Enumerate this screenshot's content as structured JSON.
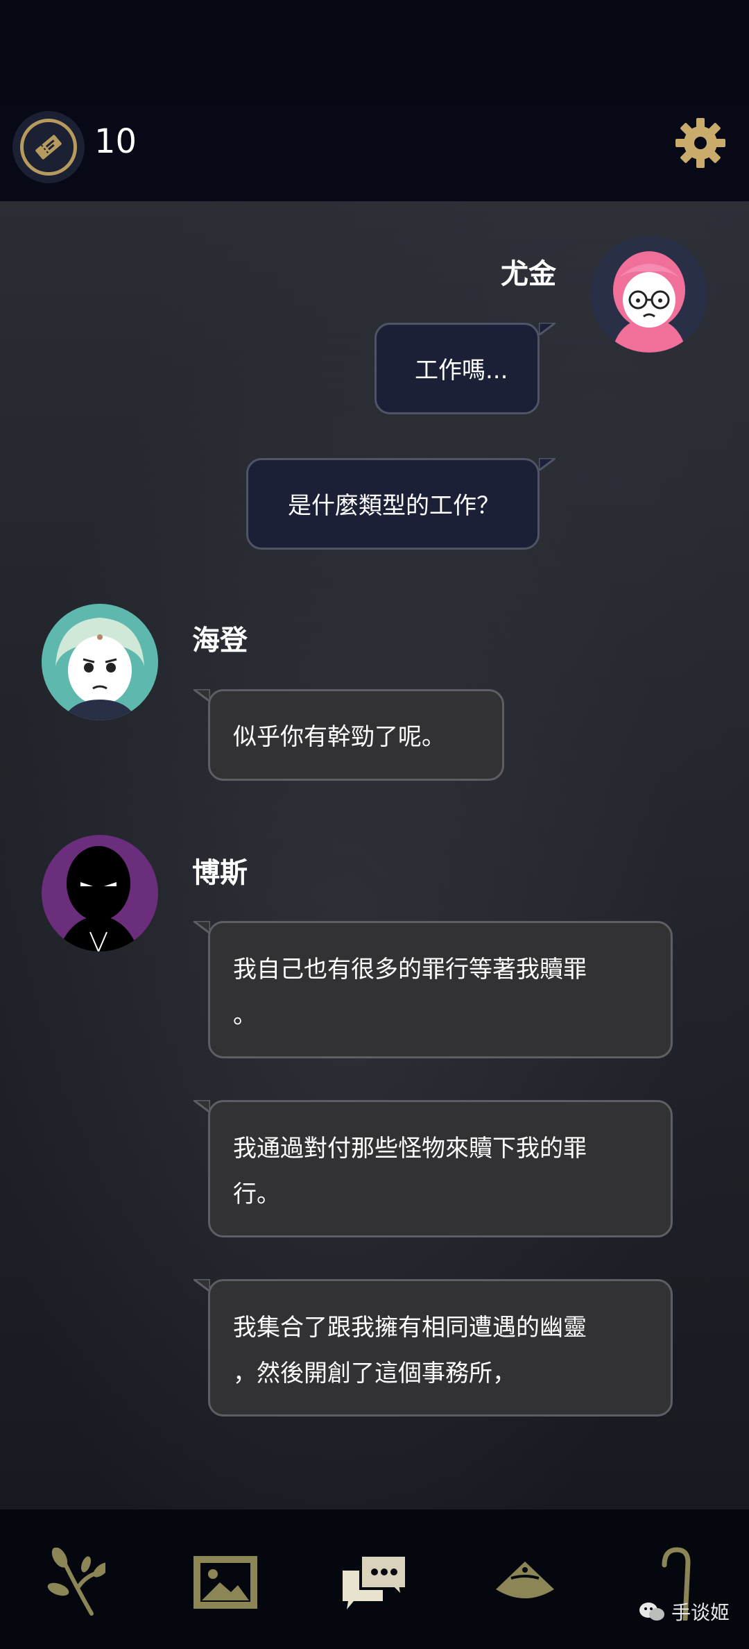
{
  "header": {
    "ticket_count": "10",
    "ticket_icon": "ticket-icon",
    "settings_icon": "gear-icon"
  },
  "chat": {
    "participants": [
      {
        "name": "尤金",
        "avatar_color": "#f1709a"
      },
      {
        "name": "海登",
        "avatar_color": "#5fb8ad"
      },
      {
        "name": "博斯",
        "avatar_color": "#6b2e7d"
      }
    ],
    "messages": [
      {
        "speaker": "尤金",
        "side": "mine",
        "text": "工作嗎..."
      },
      {
        "speaker": "尤金",
        "side": "mine",
        "text": "是什麼類型的工作？"
      },
      {
        "speaker": "海登",
        "side": "theirs",
        "text": "似乎你有幹勁了呢。"
      },
      {
        "speaker": "博斯",
        "side": "theirs",
        "text": "我自己也有很多的罪行等著我贖罪\n。"
      },
      {
        "speaker": "博斯",
        "side": "theirs",
        "text": "我通過對付那些怪物來贖下我的罪\n行。"
      },
      {
        "speaker": "博斯",
        "side": "theirs",
        "text": "我集合了跟我擁有相同遭遇的幽靈\n，然後開創了這個事務所，"
      }
    ]
  },
  "bottom_nav": {
    "items": [
      {
        "icon": "branch-icon"
      },
      {
        "icon": "gallery-icon"
      },
      {
        "icon": "chat-icon"
      },
      {
        "icon": "hat-icon"
      },
      {
        "icon": "cane-icon"
      }
    ]
  },
  "watermark": {
    "text": "手谈姬"
  },
  "colors": {
    "accent_gold": "#c9ac6c",
    "my_bubble": "#1c2036",
    "their_bubble": "#323234"
  }
}
